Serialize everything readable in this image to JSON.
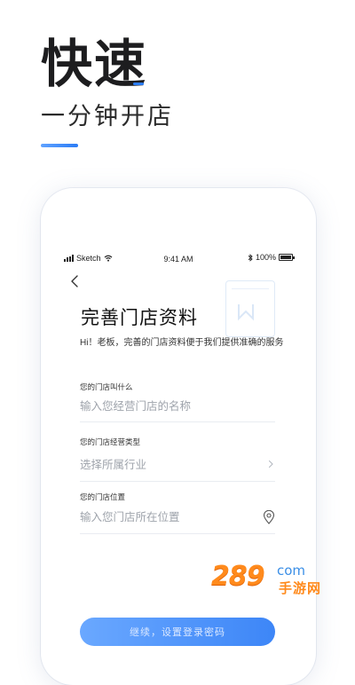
{
  "hero": {
    "title": "快速",
    "subtitle": "一分钟开店"
  },
  "status_bar": {
    "carrier": "Sketch",
    "time": "9:41 AM",
    "battery": "100%"
  },
  "form": {
    "title": "完善门店资料",
    "subtitle": "Hi！老板，完善的门店资料便于我们提供准确的服务",
    "fields": [
      {
        "label": "您的门店叫什么",
        "placeholder": "输入您经营门店的名称"
      },
      {
        "label": "您的门店经营类型",
        "placeholder": "选择所属行业"
      },
      {
        "label": "您的门店位置",
        "placeholder": "输入您门店所在位置"
      }
    ],
    "continue_label": "继续，设置登录密码"
  },
  "watermark": {
    "number": "289",
    "domain": "com",
    "chinese": "手游网"
  },
  "colors": {
    "accent": "#2b7cf6",
    "button_start": "#6aa8ff",
    "button_end": "#3d86f7",
    "watermark_orange": "#ff8a1c"
  }
}
